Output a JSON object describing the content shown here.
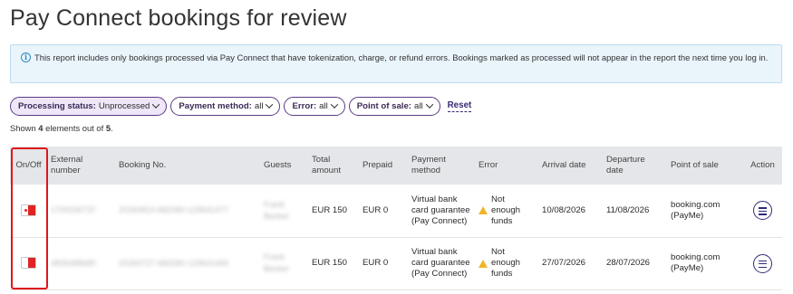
{
  "page": {
    "title": "Pay Connect bookings for review"
  },
  "info": {
    "text": "This report includes only bookings processed via Pay Connect that have tokenization, charge, or refund errors. Bookings marked as processed will not appear in the report the next time you log in."
  },
  "filters": {
    "processing_status": {
      "label": "Processing status:",
      "value": "Unprocessed"
    },
    "payment_method": {
      "label": "Payment method:",
      "value": "all"
    },
    "error": {
      "label": "Error:",
      "value": "all"
    },
    "point_of_sale": {
      "label": "Point of sale:",
      "value": "all"
    },
    "reset_label": "Reset"
  },
  "summary": {
    "prefix": "Shown",
    "shown": "4",
    "middle": "elements out of",
    "total": "5",
    "suffix": "."
  },
  "table": {
    "headers": {
      "onoff": "On/Off",
      "external": "External number",
      "booking": "Booking No.",
      "guests": "Guests",
      "total": "Total amount",
      "prepaid": "Prepaid",
      "payment": "Payment method",
      "error": "Error",
      "arrival": "Arrival date",
      "departure": "Departure date",
      "pos": "Point of sale",
      "action": "Action"
    },
    "rows": [
      {
        "external": "1709156737",
        "booking": "20260810-682080-129641477",
        "guests": "Frank Becker",
        "total": "EUR 150",
        "prepaid": "EUR 0",
        "payment": "Virtual bank card guarantee (Pay Connect)",
        "error": "Not enough funds",
        "arrival": "10/08/2026",
        "departure": "11/08/2026",
        "pos": "booking.com (PayMe)"
      },
      {
        "external": "4835488680",
        "booking": "20260727-682080-129641469",
        "guests": "Frank Becker",
        "total": "EUR 150",
        "prepaid": "EUR 0",
        "payment": "Virtual bank card guarantee (Pay Connect)",
        "error": "Not enough funds",
        "arrival": "27/07/2026",
        "departure": "28/07/2026",
        "pos": "booking.com (PayMe)"
      }
    ]
  },
  "colors": {
    "accent": "#5b3b85",
    "toggle_off": "#e02424",
    "warning": "#f0b429",
    "highlight": "#e0161b"
  }
}
